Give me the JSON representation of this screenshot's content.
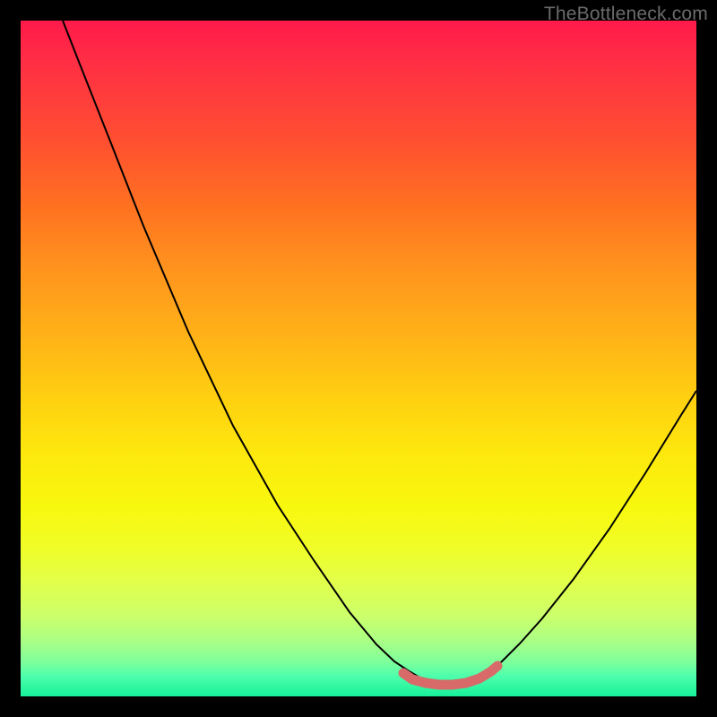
{
  "watermark": "TheBottleneck.com",
  "chart_data": {
    "type": "line",
    "title": "",
    "xlabel": "",
    "ylabel": "",
    "xlim": [
      23,
      777
    ],
    "ylim": [
      23,
      777
    ],
    "series": [
      {
        "name": "curve",
        "stroke": "#000000",
        "stroke_width": 2,
        "points": [
          [
            70,
            23
          ],
          [
            90,
            74
          ],
          [
            120,
            150
          ],
          [
            160,
            252
          ],
          [
            210,
            370
          ],
          [
            260,
            475
          ],
          [
            310,
            564
          ],
          [
            350,
            625
          ],
          [
            390,
            683
          ],
          [
            420,
            719
          ],
          [
            440,
            738
          ],
          [
            455,
            748
          ],
          [
            470,
            757
          ],
          [
            485,
            762
          ],
          [
            500,
            763
          ],
          [
            515,
            762
          ],
          [
            530,
            757
          ],
          [
            545,
            749
          ],
          [
            560,
            738
          ],
          [
            580,
            718
          ],
          [
            605,
            690
          ],
          [
            640,
            646
          ],
          [
            680,
            590
          ],
          [
            720,
            528
          ],
          [
            760,
            463
          ],
          [
            777,
            436
          ]
        ]
      },
      {
        "name": "base-accent",
        "stroke": "#d96a6a",
        "stroke_width": 11,
        "stroke_linecap": "round",
        "points": [
          [
            450,
            751
          ],
          [
            460,
            758
          ],
          [
            475,
            762
          ],
          [
            490,
            764
          ],
          [
            505,
            764
          ],
          [
            520,
            762
          ],
          [
            535,
            757
          ],
          [
            548,
            749
          ],
          [
            555,
            743
          ]
        ]
      }
    ]
  }
}
